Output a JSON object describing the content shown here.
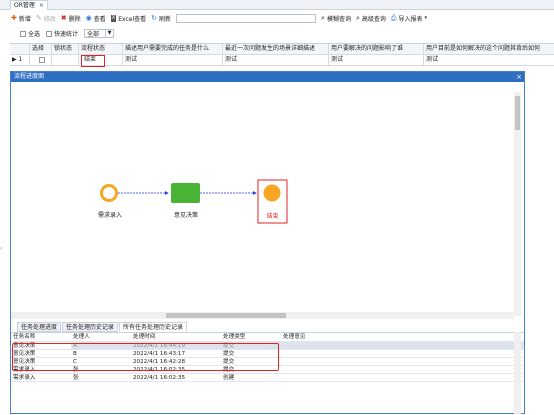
{
  "app": {
    "tab_title": "OR管理",
    "tab_close": "×"
  },
  "toolbar": {
    "new": "新增",
    "edit": "修改",
    "delete": "删除",
    "view": "查看",
    "excel": "Excel查看",
    "refresh": "刷新",
    "fuzzy": "模糊查询",
    "advanced": "高级查询",
    "export": "导入报表",
    "icons": {
      "new": "plus-icon",
      "edit": "pencil-icon",
      "delete": "x-icon",
      "view": "eye-icon",
      "excel": "excel-icon",
      "refresh": "refresh-icon",
      "fuzzy": "search-icon",
      "advanced": "search-icon",
      "export": "printer-icon"
    }
  },
  "filter": {
    "all_label": "全选",
    "quick_label": "快速统计",
    "select_value": "全部"
  },
  "grid": {
    "headers": [
      "",
      "选择",
      "锁状态",
      "流程状态",
      "描述用户需要完成的任务是什么",
      "最近一次问题发生的场景详细描述",
      "用户要解决的问题影响了谁",
      "用户目前是如何解决的这个问题其背后如何"
    ],
    "row": {
      "marker": "▶ 1",
      "status": "结束",
      "c1": "测试",
      "c2": "测试",
      "c3": "测试",
      "c4": "测试"
    }
  },
  "dialog": {
    "title": "流程进度图",
    "close": "×",
    "nodes": {
      "start": "需求录入",
      "task": "意见决策",
      "end": "结束"
    },
    "colors": {
      "title_bar": "#2f6fc3",
      "start_ring": "#f6a623",
      "task": "#49b336",
      "end_fill": "#f6a623",
      "end_border": "#e02424"
    }
  },
  "subtabs": [
    "任务处理进度",
    "任务处理历史记录",
    "所有任务处理历史记录"
  ],
  "history": {
    "headers": [
      "任务名称",
      "处理人",
      "处理时间",
      "处理类型",
      "处理意见"
    ],
    "rows": [
      [
        "意见决策",
        "A",
        "2022/4/1 16:44:19",
        "提交",
        ""
      ],
      [
        "意见决策",
        "B",
        "2022/4/1 16:43:17",
        "提交",
        ""
      ],
      [
        "意见决策",
        "C",
        "2022/4/1 16:42:28",
        "提交",
        ""
      ],
      [
        "需求录入",
        "张",
        "2022/4/1 16:02:35",
        "提交",
        ""
      ],
      [
        "需求录入",
        "张",
        "2022/4/1 16:02:35",
        "创建",
        ""
      ]
    ]
  }
}
